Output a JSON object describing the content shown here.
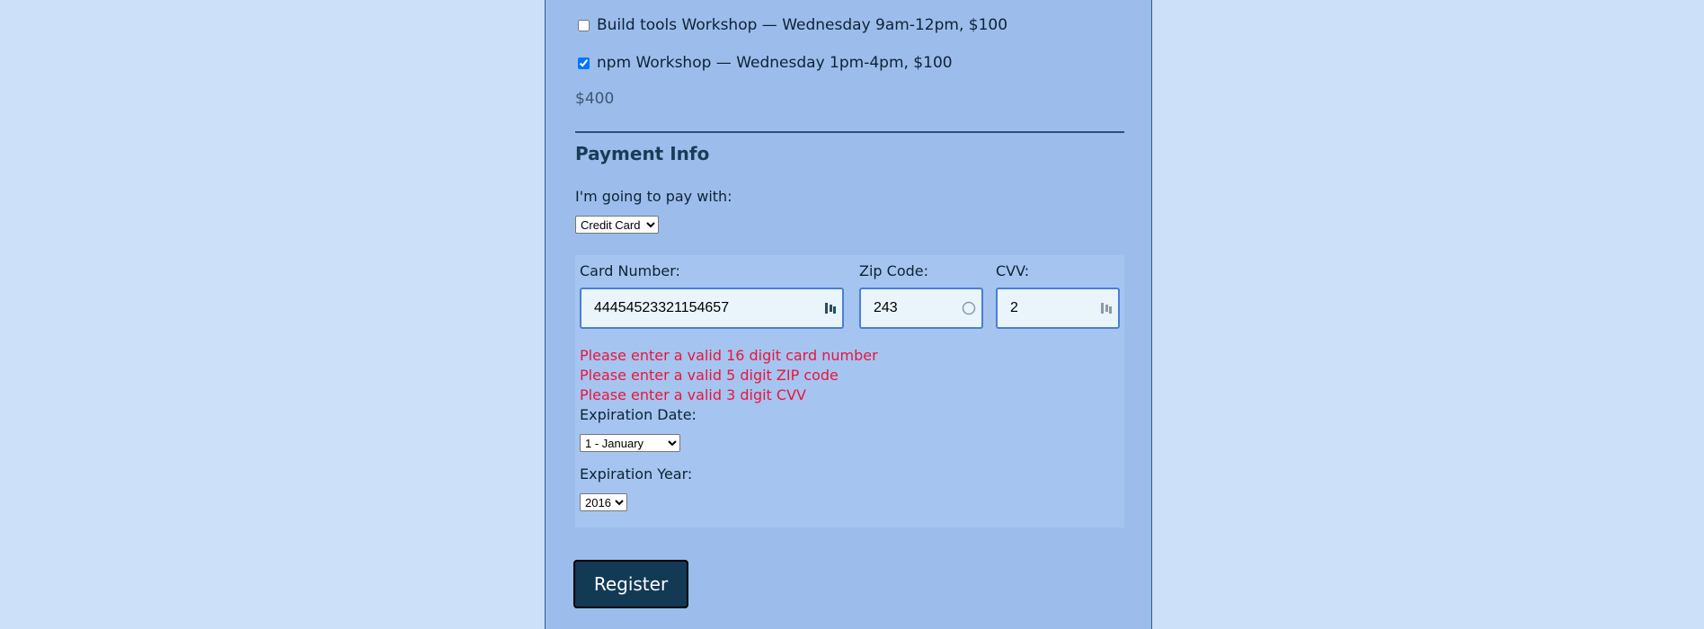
{
  "activities": [
    {
      "label": "Build tools Workshop — Wednesday 9am-12pm, $100",
      "checked": false
    },
    {
      "label": "npm Workshop — Wednesday 1pm-4pm, $100",
      "checked": true
    }
  ],
  "total": "$400",
  "payment": {
    "title": "Payment Info",
    "pay_label": "I'm going to pay with:",
    "selected_method": "Credit Card"
  },
  "credit_card": {
    "card_number_label": "Card Number:",
    "card_number_value": "44454523321154657",
    "zip_label": "Zip Code:",
    "zip_value": "243",
    "cvv_label": "CVV:",
    "cvv_value": "2",
    "errors": [
      "Please enter a valid 16 digit card number",
      "Please enter a valid 5 digit ZIP code",
      "Please enter a valid 3 digit CVV"
    ],
    "exp_date_label": "Expiration Date:",
    "exp_date_selected": "1 - January",
    "exp_year_label": "Expiration Year:",
    "exp_year_selected": "2016"
  },
  "register_label": "Register",
  "colors": {
    "page_bg": "#cde0f9",
    "panel_bg": "#9cbdec",
    "card_box_bg": "#a5c5f0",
    "error": "#e8163d",
    "button_bg": "#123a55",
    "input_border": "#4a7fd4"
  }
}
